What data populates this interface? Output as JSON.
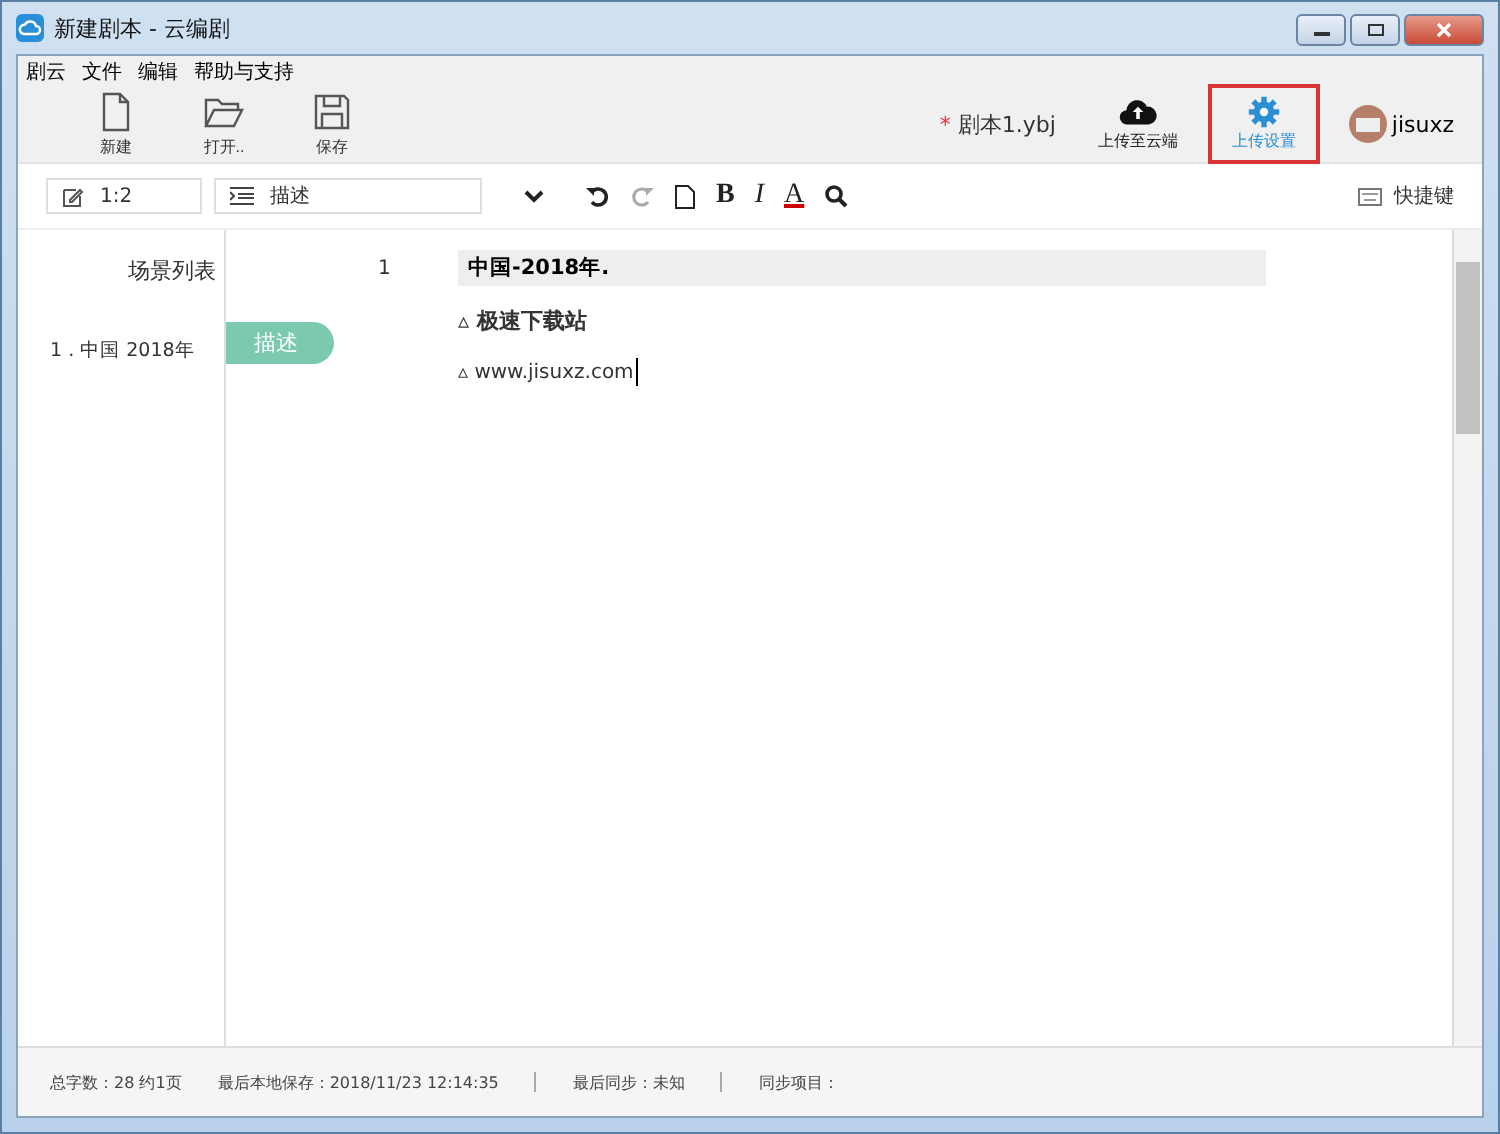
{
  "window": {
    "title": "新建剧本 - 云编剧"
  },
  "menu": [
    "剧云",
    "文件",
    "编辑",
    "帮助与支持"
  ],
  "toolbar": [
    {
      "kind": "new",
      "label": "新建"
    },
    {
      "kind": "open",
      "label": "打开.."
    },
    {
      "kind": "save",
      "label": "保存"
    }
  ],
  "document": {
    "modified_mark": "*",
    "name": "剧本1.ybj"
  },
  "actions": [
    {
      "kind": "upload",
      "label": "上传至云端",
      "selected": false
    },
    {
      "kind": "settings",
      "label": "上传设置",
      "selected": true
    }
  ],
  "user": {
    "name": "jisuxz"
  },
  "format_bar": {
    "position": "1:2",
    "element": "描述",
    "buttons": [
      {
        "kind": "undo",
        "disabled": false
      },
      {
        "kind": "redo",
        "disabled": true
      },
      {
        "kind": "page",
        "disabled": false
      },
      {
        "kind": "bold",
        "text": "B",
        "disabled": false
      },
      {
        "kind": "italic",
        "text": "I",
        "disabled": false
      },
      {
        "kind": "color",
        "text": "A",
        "disabled": false
      },
      {
        "kind": "search",
        "disabled": false
      }
    ],
    "shortcuts": "快捷键"
  },
  "scene_list": {
    "title": "场景列表",
    "items": [
      {
        "label": "1 . 中国 2018年"
      }
    ]
  },
  "element_tag": "描述",
  "script": {
    "scene_number": "1",
    "heading": "中国-2018年.",
    "lines": [
      "极速下载站",
      "www.jisuxz.com"
    ],
    "line_mark": "▵"
  },
  "status_bar": [
    "总字数：28 约1页",
    "最后本地保存：2018/11/23 12:14:35",
    "最后同步：未知",
    "同步项目："
  ]
}
